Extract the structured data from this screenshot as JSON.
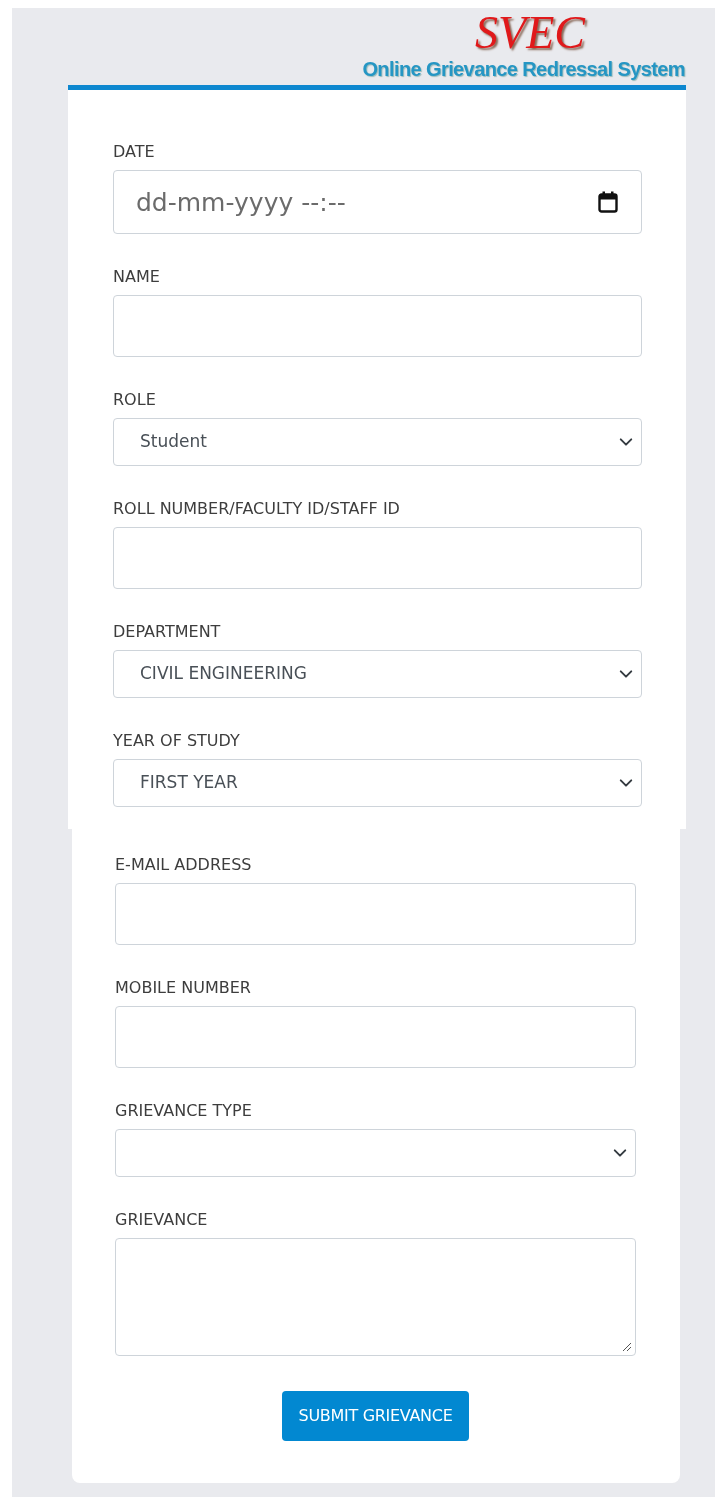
{
  "header": {
    "logo": "SVEC",
    "subtitle": "Online Grievance Redressal System"
  },
  "sections": [
    {
      "fields": [
        {
          "kind": "datetime",
          "label": "DATE",
          "placeholder": "dd-mm-yyyy --:--"
        },
        {
          "kind": "text",
          "label": "NAME"
        },
        {
          "kind": "select",
          "label": "ROLE",
          "value": "Student"
        },
        {
          "kind": "text",
          "label": "ROLL NUMBER/FACULTY ID/STAFF ID"
        },
        {
          "kind": "select",
          "label": "DEPARTMENT",
          "value": "CIVIL ENGINEERING"
        },
        {
          "kind": "select",
          "label": "YEAR OF STUDY",
          "value": "FIRST YEAR"
        }
      ]
    },
    {
      "fields": [
        {
          "kind": "text",
          "label": "E-MAIL ADDRESS"
        },
        {
          "kind": "text",
          "label": "MOBILE NUMBER"
        },
        {
          "kind": "select",
          "label": "GRIEVANCE TYPE"
        },
        {
          "kind": "textarea",
          "label": "GRIEVANCE"
        }
      ]
    }
  ],
  "submit": "SUBMIT GRIEVANCE"
}
